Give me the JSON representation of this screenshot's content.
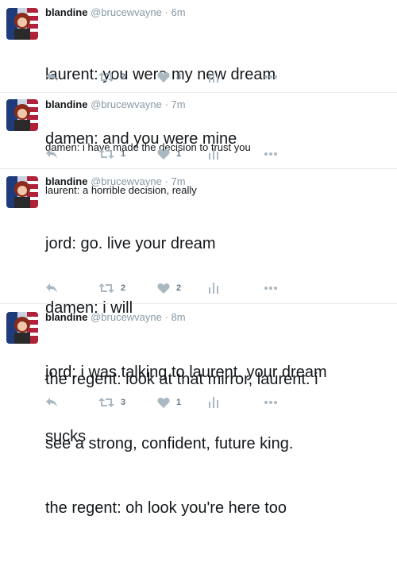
{
  "colors": {
    "text": "#14171a",
    "meta": "#8899a6",
    "icon": "#aab8c2",
    "divider": "#e6ecf0"
  },
  "icons": {
    "reply": "reply-icon",
    "retweet": "retweet-icon",
    "like": "heart-icon",
    "analytics": "analytics-icon",
    "more": "more-dots-icon"
  },
  "tweets": [
    {
      "fullname": "blandine",
      "username": "@brucewvayne",
      "sep": "·",
      "time": "6m",
      "lines": [
        "laurent: you were my new dream",
        "damen: and you were mine"
      ],
      "retweets": "2",
      "likes": "3"
    },
    {
      "fullname": "blandine",
      "username": "@brucewvayne",
      "sep": "·",
      "time": "7m",
      "lines": [
        "damen: i have made the decision to trust you",
        "laurent: a horrible decision, really"
      ],
      "retweets": "1",
      "likes": "1"
    },
    {
      "fullname": "blandine",
      "username": "@brucewvayne",
      "sep": "·",
      "time": "7m",
      "lines": [
        "jord: go. live your dream",
        "damen: i will",
        "jord: i was talking to laurent. your dream",
        "sucks"
      ],
      "retweets": "2",
      "likes": "2"
    },
    {
      "fullname": "blandine",
      "username": "@brucewvayne",
      "sep": "·",
      "time": "8m",
      "lines": [
        "the regent: look at that mirror, laurent. i",
        "see a strong, confident, future king.",
        "the regent: oh look you're here too"
      ],
      "retweets": "3",
      "likes": "1"
    }
  ]
}
